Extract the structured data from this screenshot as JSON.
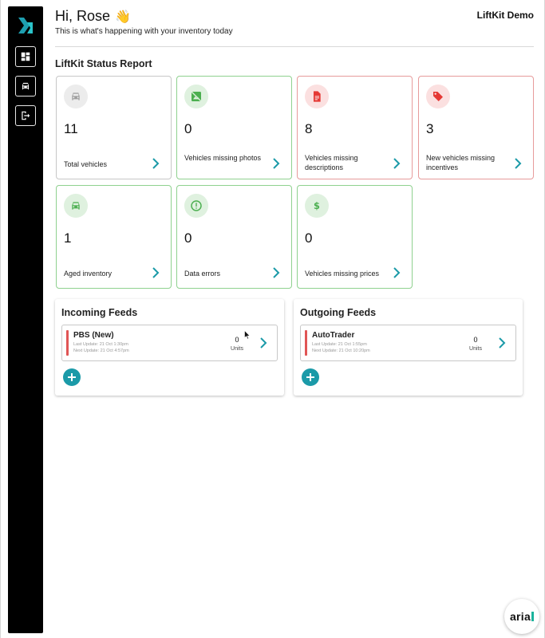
{
  "header": {
    "greeting": "Hi, Rose",
    "greeting_emoji": "👋",
    "subtitle": "This is what's happening with your inventory today",
    "account_name": "LiftKit Demo"
  },
  "sidebar": {
    "items": [
      {
        "name": "dashboard",
        "icon": "dashboard-icon"
      },
      {
        "name": "vehicles",
        "icon": "car-icon"
      },
      {
        "name": "logout",
        "icon": "logout-icon"
      }
    ]
  },
  "report": {
    "title": "LiftKit Status Report",
    "cards": [
      {
        "count": "11",
        "label": "Total vehicles",
        "icon": "car-icon",
        "tone": "grey"
      },
      {
        "count": "0",
        "label": "Vehicles missing photos",
        "icon": "no-photo-icon",
        "tone": "green"
      },
      {
        "count": "8",
        "label": "Vehicles missing descriptions",
        "icon": "document-icon",
        "tone": "red"
      },
      {
        "count": "3",
        "label": "New vehicles missing incentives",
        "icon": "tag-icon",
        "tone": "red"
      },
      {
        "count": "1",
        "label": "Aged inventory",
        "icon": "car-icon",
        "tone": "green"
      },
      {
        "count": "0",
        "label": "Data errors",
        "icon": "alert-icon",
        "tone": "green"
      },
      {
        "count": "0",
        "label": "Vehicles missing prices",
        "icon": "dollar-icon",
        "tone": "green"
      }
    ]
  },
  "incoming": {
    "title": "Incoming Feeds",
    "feed": {
      "name": "PBS (New)",
      "last_update": "Last Update: 21 Oct 1:30pm",
      "next_update": "Next Update: 21 Oct 4:57pm",
      "units": "0",
      "units_label": "Units"
    }
  },
  "outgoing": {
    "title": "Outgoing Feeds",
    "feed": {
      "name": "AutoTrader",
      "last_update": "Last Update: 21 Oct 1:55pm",
      "next_update": "Next Update: 21 Oct 10:20pm",
      "units": "0",
      "units_label": "Units"
    }
  },
  "badge": {
    "text": "aria"
  },
  "colors": {
    "accent": "#1b9aa8",
    "grey_icon": "#9e9e9e",
    "green_icon": "#4caf50",
    "red_icon": "#e53935"
  }
}
